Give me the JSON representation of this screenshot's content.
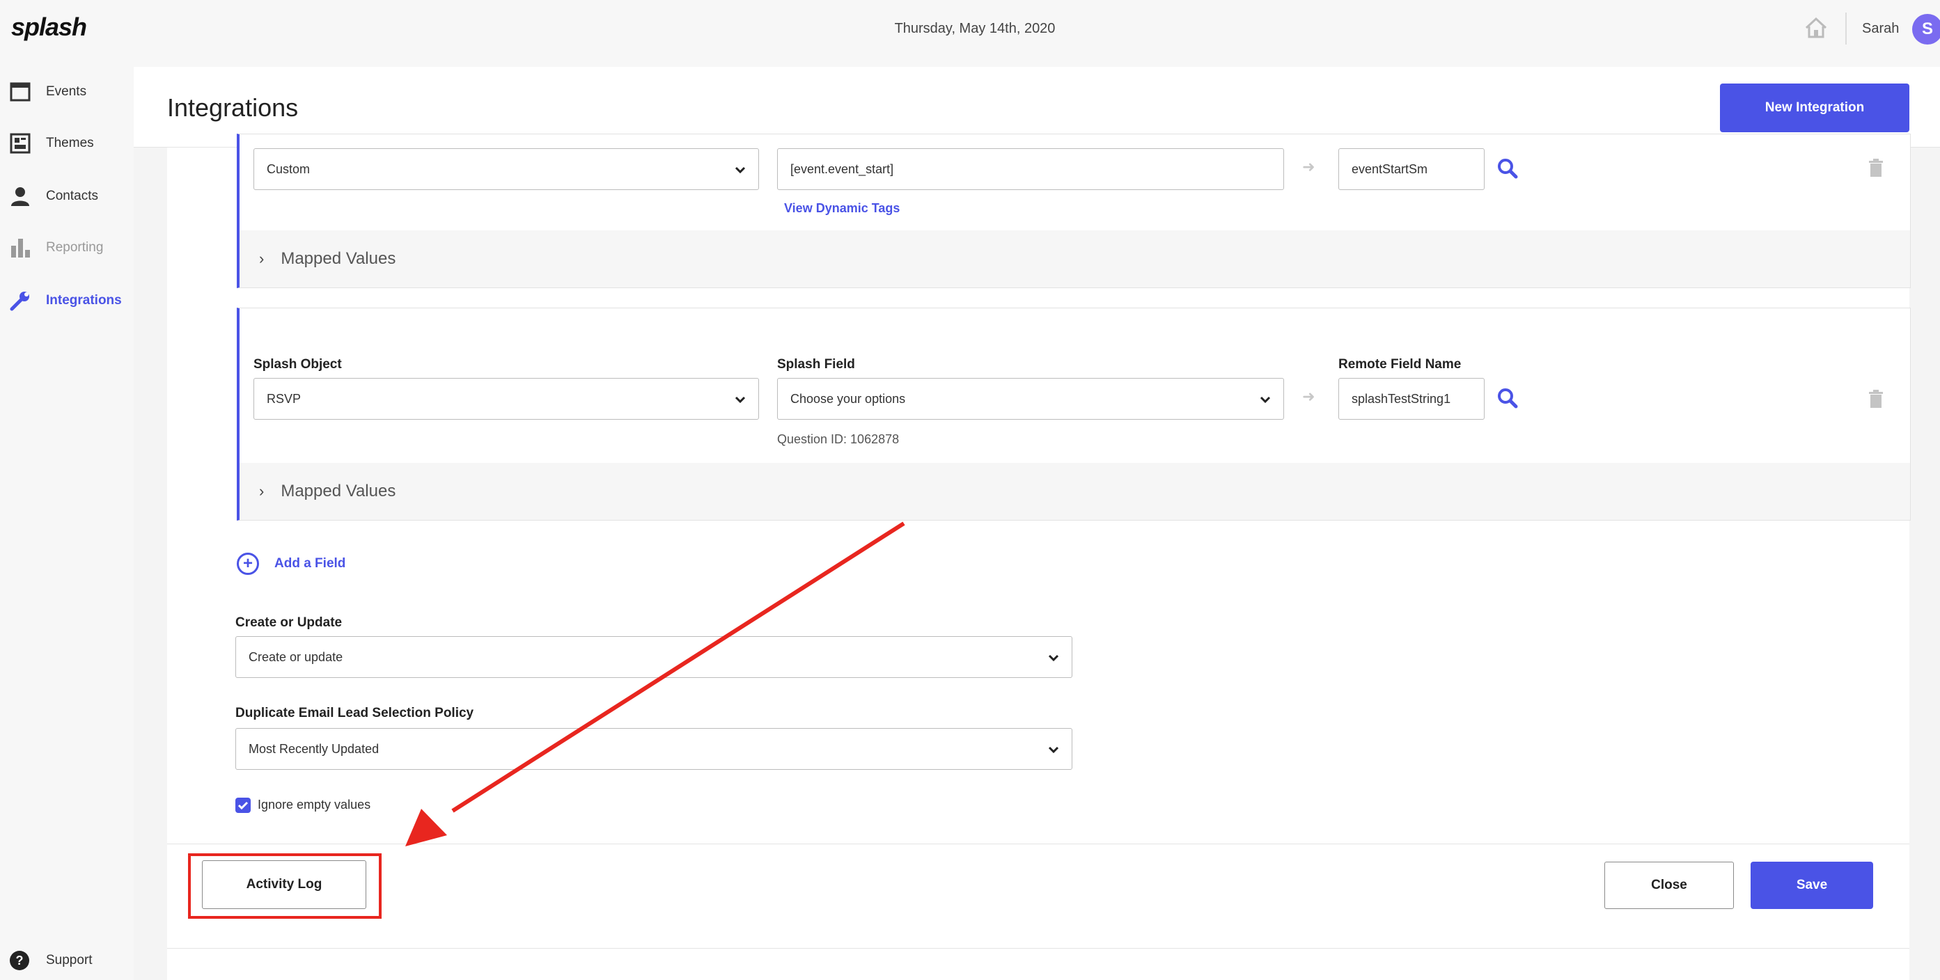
{
  "app": {
    "logo": "splash",
    "date": "Thursday, May 14th, 2020",
    "user_name": "Sarah",
    "avatar_letter": "S"
  },
  "sidebar": {
    "items": [
      {
        "label": "Events",
        "icon": "calendar-icon"
      },
      {
        "label": "Themes",
        "icon": "theme-icon"
      },
      {
        "label": "Contacts",
        "icon": "person-icon"
      },
      {
        "label": "Reporting",
        "icon": "bar-chart-icon"
      },
      {
        "label": "Integrations",
        "icon": "wrench-icon",
        "active": true
      }
    ],
    "support_label": "Support"
  },
  "header": {
    "title": "Integrations",
    "new_button": "New Integration"
  },
  "field_rows": [
    {
      "splash_object": "Custom",
      "splash_field_value": "[event.event_start]",
      "dynamic_tags_link": "View Dynamic Tags",
      "remote_field_name": "eventStartSm",
      "mapped_values_label": "Mapped Values"
    },
    {
      "labels": {
        "splash_object": "Splash Object",
        "splash_field": "Splash Field",
        "remote_field": "Remote Field Name"
      },
      "splash_object": "RSVP",
      "splash_field_value": "Choose your options",
      "question_id": "Question ID: 1062878",
      "remote_field_name": "splashTestString1",
      "mapped_values_label": "Mapped Values"
    }
  ],
  "add_field_label": "Add a Field",
  "create_or_update": {
    "label": "Create or Update",
    "value": "Create or update"
  },
  "duplicate_policy": {
    "label": "Duplicate Email Lead Selection Policy",
    "value": "Most Recently Updated"
  },
  "ignore_empty": {
    "label": "Ignore empty values",
    "checked": true
  },
  "footer": {
    "activity_log": "Activity Log",
    "close": "Close",
    "save": "Save"
  },
  "colors": {
    "accent": "#4a53e6",
    "annotation": "#e8261f"
  }
}
